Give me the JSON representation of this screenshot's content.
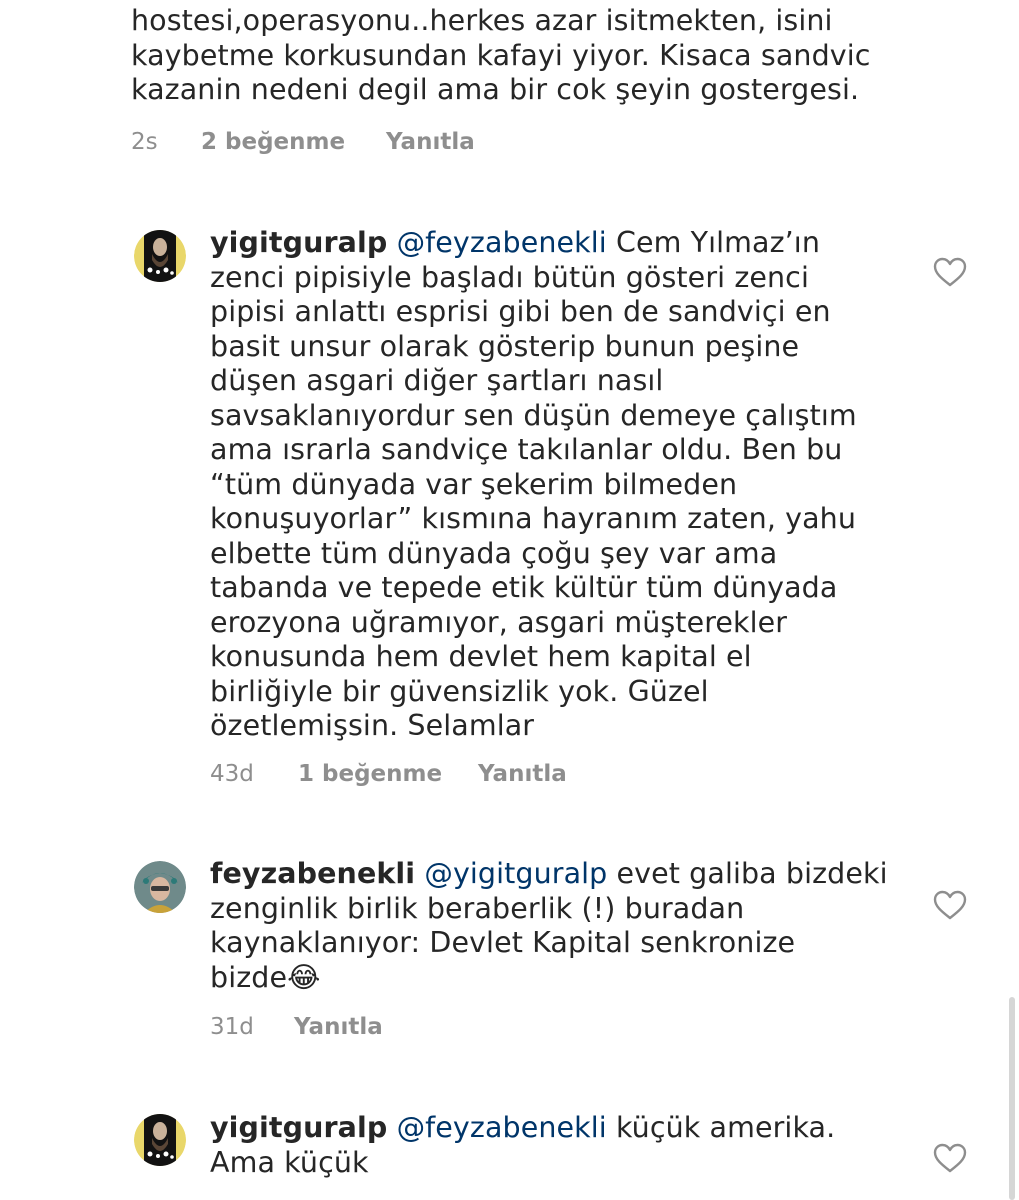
{
  "top_comment": {
    "lines": "hostesi,operasyonu..herkes azar isitmekten, isini\nkaybetme korkusundan kafayi yiyor. Kisaca sandvic\nkazanin nedeni degil ama bir cok şeyin gostergesi.",
    "time": "2s",
    "likes": "2 beğenme",
    "reply": "Yanıtla"
  },
  "comment_1": {
    "username": "yigitguralp",
    "mention": "@feyzabenekli",
    "text": " Cem Yılmaz’ın\nzenci pipisiyle başladı bütün gösteri zenci\npipisi anlattı esprisi gibi ben de sandviçi en\nbasit unsur olarak gösterip bunun peşine\ndüşen asgari diğer şartları nasıl\nsavsaklanıyordur sen düşün demeye çalıştım\nama ısrarla sandviçe takılanlar oldu. Ben bu\n“tüm dünyada var şekerim bilmeden\nkonuşuyorlar” kısmına hayranım zaten, yahu\nelbette tüm dünyada çoğu şey var ama\ntabanda ve tepede etik kültür tüm dünyada\nerozyona uğramıyor, asgari müşterekler\nkonusunda hem devlet hem kapital el\nbirliğiyle bir güvensizlik yok. Güzel\nözetlemişsin. Selamlar",
    "time": "43d",
    "likes": "1 beğenme",
    "reply": "Yanıtla"
  },
  "comment_2": {
    "username": "feyzabenekli",
    "mention": "@yigitguralp",
    "text": " evet galiba bizdeki\nzenginlik birlik beraberlik (!) buradan\nkaynaklanıyor: Devlet Kapital senkronize\nbizde😂",
    "time": "31d",
    "reply": "Yanıtla"
  },
  "comment_3": {
    "username": "yigitguralp",
    "mention": "@feyzabenekli",
    "text": " küçük amerika.\nAma küçük"
  },
  "icons": {
    "like": "heart-outline-icon"
  },
  "colors": {
    "text": "#262626",
    "mention": "#003569",
    "meta": "#8e8e8e"
  }
}
